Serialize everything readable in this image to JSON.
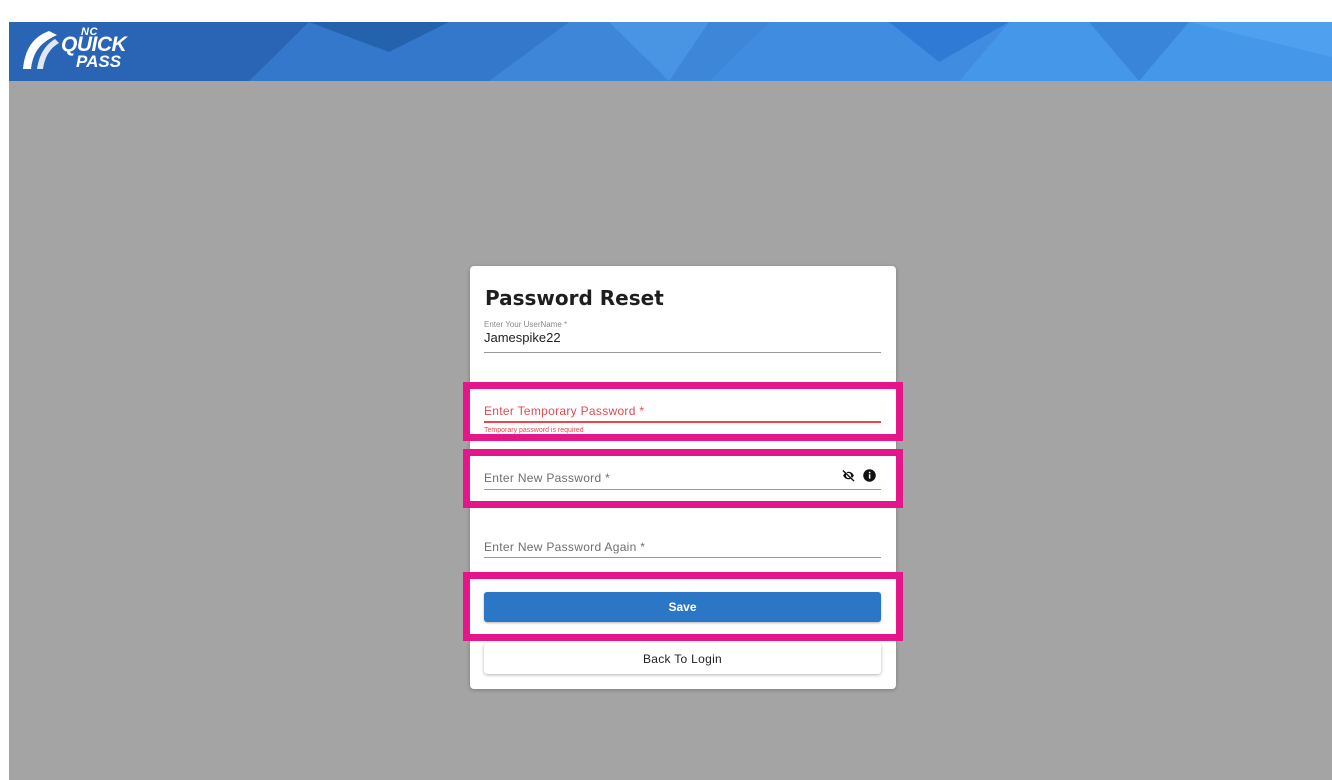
{
  "header": {
    "logo": {
      "nc": "NC",
      "quick": "QUICK",
      "pass": "PASS"
    }
  },
  "form": {
    "title": "Password Reset",
    "username": {
      "label": "Enter Your UserName *",
      "value": "Jamespike22"
    },
    "temp_password": {
      "placeholder": "Enter Temporary Password *",
      "helper": "Temporary password is required"
    },
    "new_password": {
      "placeholder": "Enter New Password *",
      "icons": [
        "visibility-off-icon",
        "info-icon"
      ]
    },
    "new_password_again": {
      "placeholder": "Enter New Password Again *"
    },
    "save_label": "Save",
    "back_label": "Back To Login"
  },
  "colors": {
    "accent": "#2b77c6",
    "error": "#e8474f",
    "highlight": "#e5158a",
    "overlay": "#a4a4a4"
  }
}
